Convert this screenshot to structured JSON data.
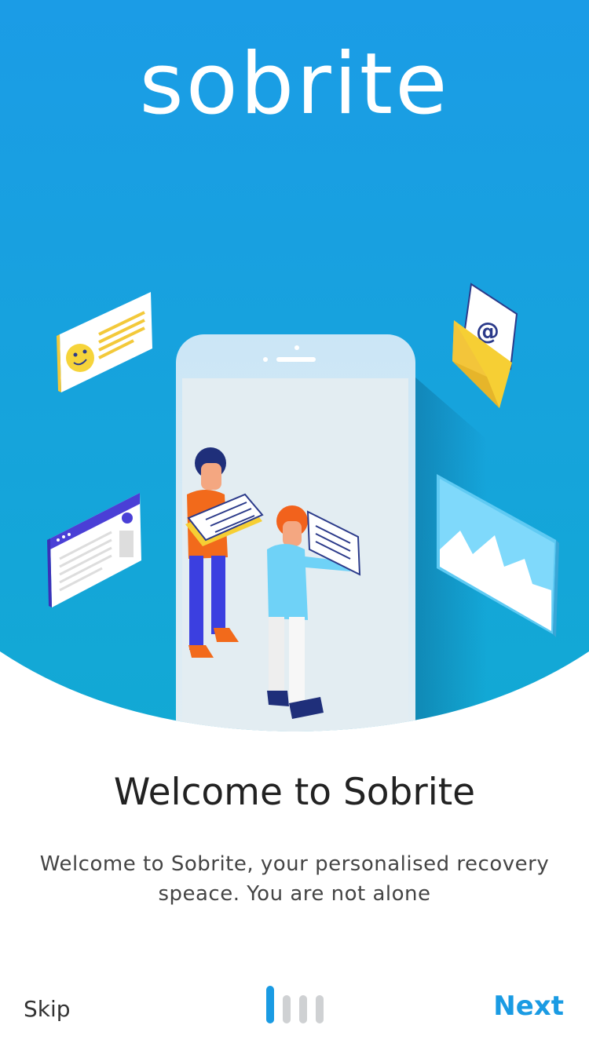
{
  "brand": {
    "name": "sobrite"
  },
  "colors": {
    "accent": "#1a9be3",
    "hero_top": "#1b9ce6",
    "hero_bottom": "#13a7d6",
    "indicator_inactive": "#cfd1d3"
  },
  "illustration": {
    "icons": [
      "chat-card-icon",
      "email-envelope-icon",
      "browser-window-icon",
      "image-card-icon",
      "phone-illustration"
    ]
  },
  "onboarding": {
    "title": "Welcome to Sobrite",
    "description": "Welcome to Sobrite, your personalised recovery speace. You are not alone",
    "current_page": 1,
    "total_pages": 4
  },
  "nav": {
    "skip_label": "Skip",
    "next_label": "Next"
  }
}
